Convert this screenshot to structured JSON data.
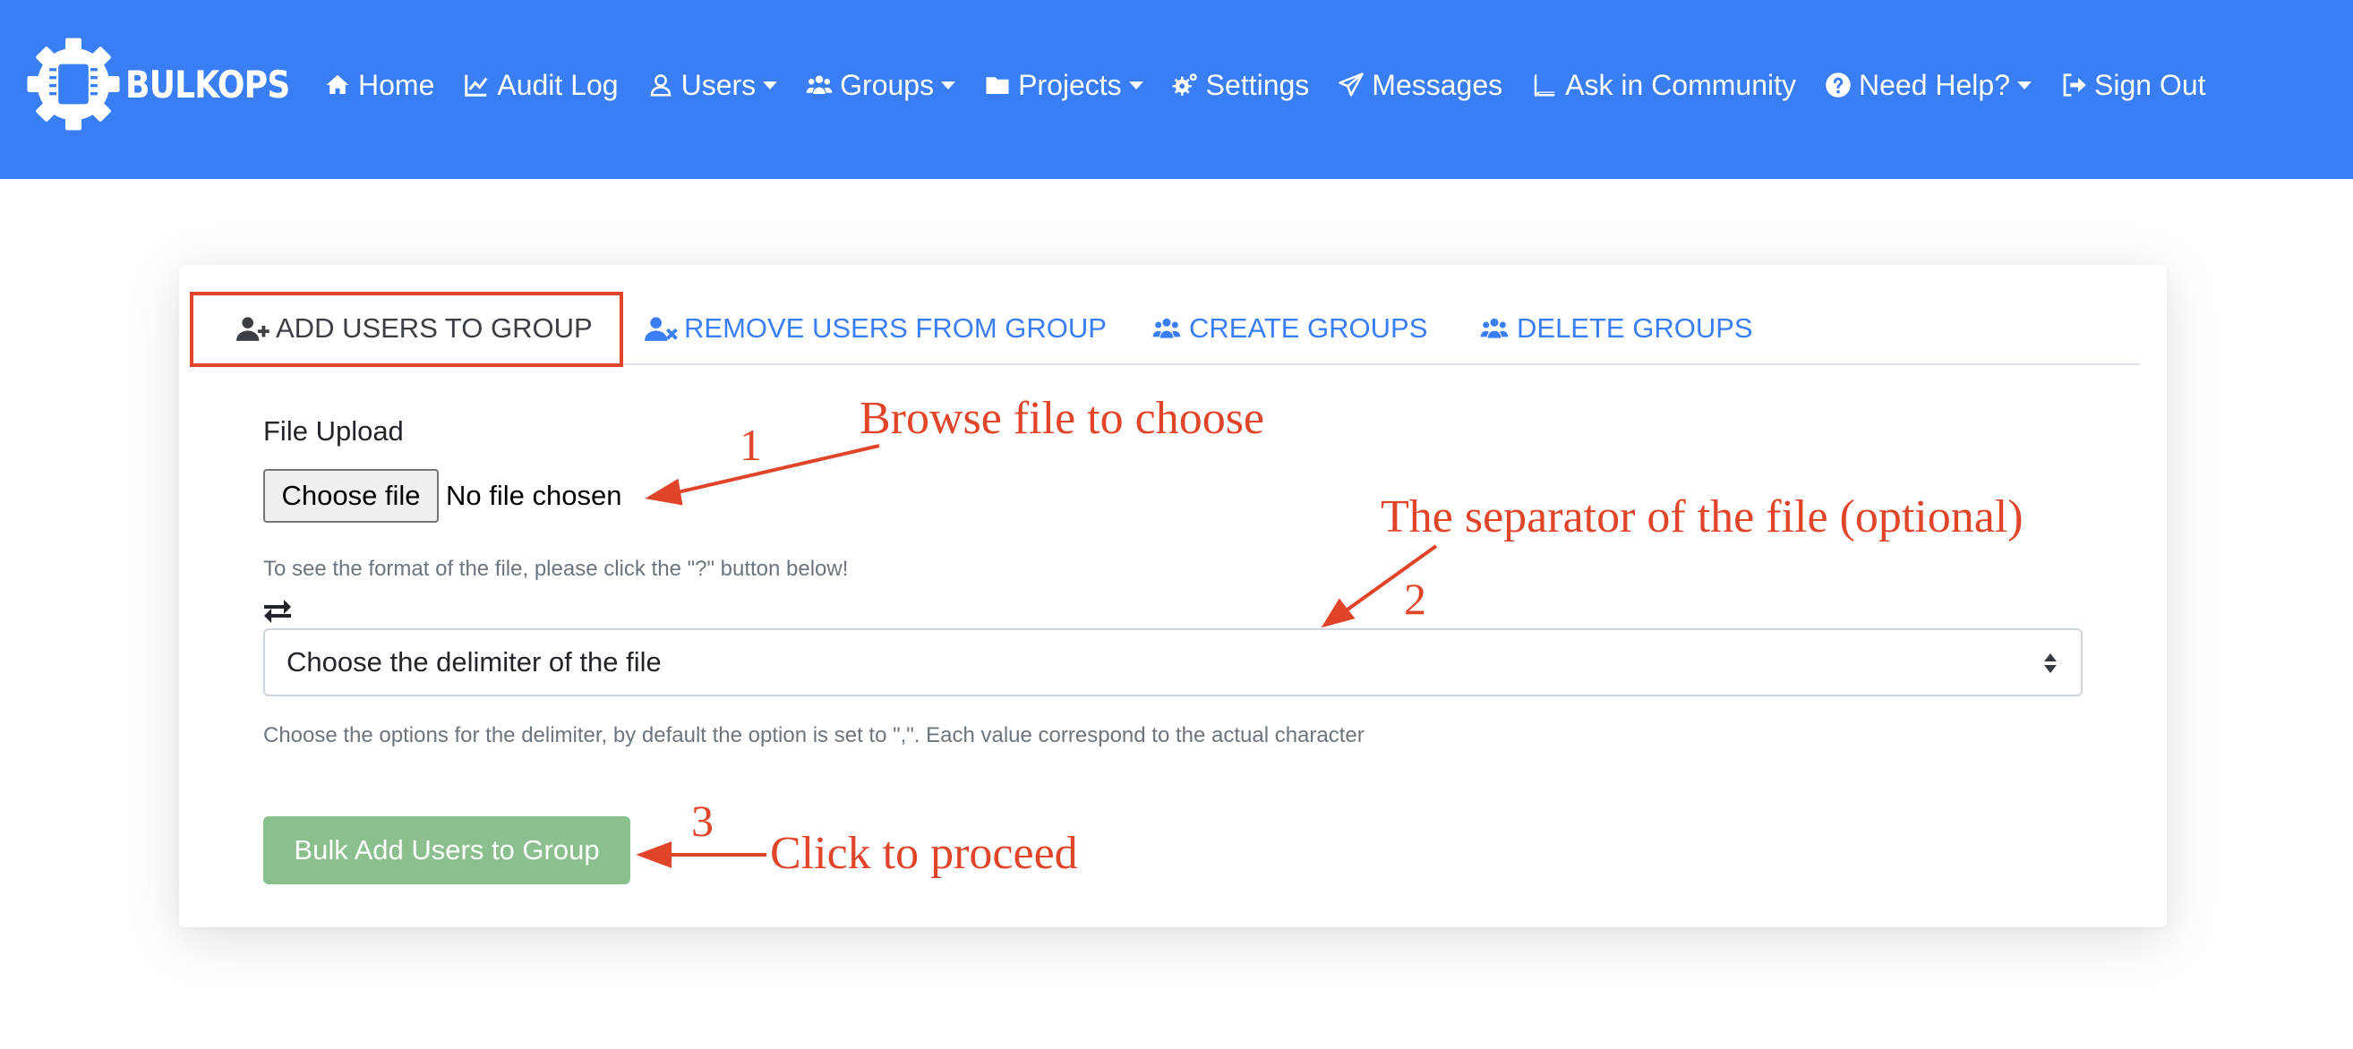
{
  "brand": {
    "name": "BULKOPS"
  },
  "nav": {
    "home": "Home",
    "audit_log": "Audit Log",
    "users": "Users",
    "groups": "Groups",
    "projects": "Projects",
    "settings": "Settings",
    "messages": "Messages",
    "ask_community": "Ask in Community",
    "need_help": "Need Help?",
    "sign_out": "Sign Out"
  },
  "tabs": [
    {
      "label": "ADD USERS TO GROUP",
      "active": true
    },
    {
      "label": "REMOVE USERS FROM GROUP",
      "active": false
    },
    {
      "label": "CREATE GROUPS",
      "active": false
    },
    {
      "label": "DELETE GROUPS",
      "active": false
    }
  ],
  "form": {
    "file_label": "File Upload",
    "file_button": "Choose file",
    "file_status": "No file chosen",
    "file_help": "To see the format of the file, please click the \"?\" button below!",
    "delimiter_placeholder": "Choose the delimiter of the file",
    "delimiter_help": "Choose the options for the delimiter, by default the option is set to \",\". Each value correspond to the actual character",
    "submit_label": "Bulk Add Users to Group"
  },
  "annotations": {
    "step1_num": "1",
    "step1_text": "Browse file to choose",
    "step2_num": "2",
    "step2_text": "The separator of the file (optional)",
    "step3_num": "3",
    "step3_text": "Click to proceed"
  },
  "colors": {
    "navbar": "#3a7ef6",
    "link": "#3a7ef6",
    "annotation": "#e0452a",
    "submit": "#8bc08e"
  }
}
